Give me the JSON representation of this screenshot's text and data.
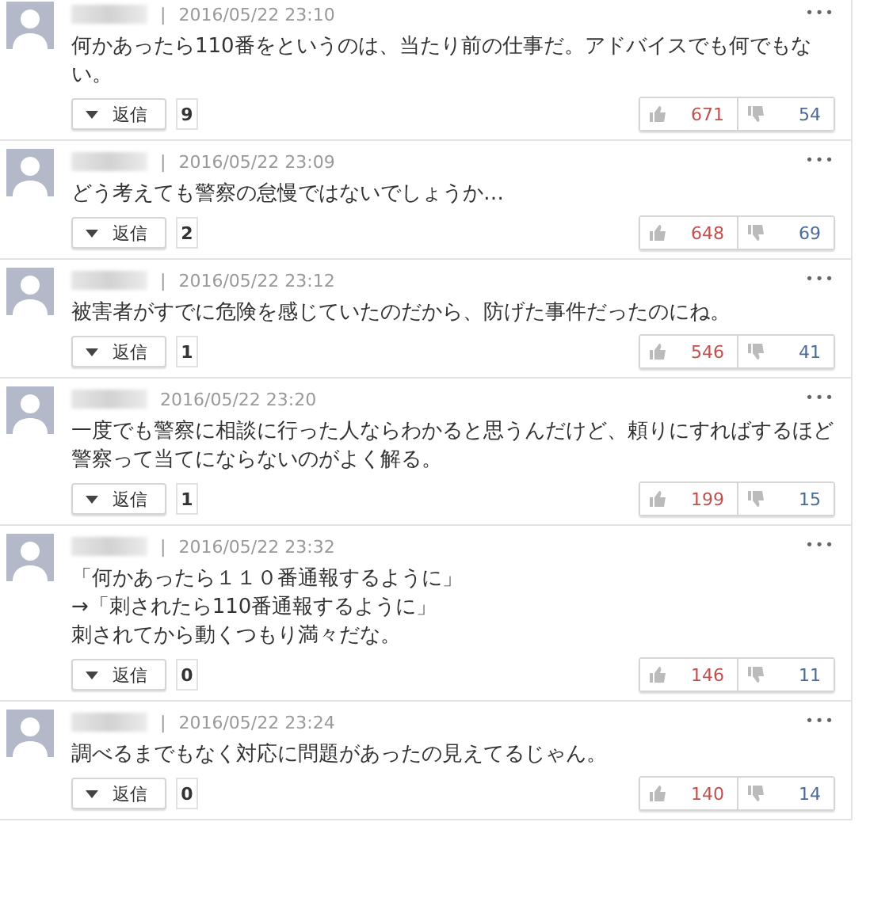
{
  "comments": [
    {
      "separator": "|",
      "date": "2016/05/22 23:10",
      "text": "何かあったら110番をというのは、当たり前の仕事だ。アドバイスでも何でもない。",
      "reply_label": "返信",
      "reply_count": "9",
      "likes": "671",
      "dislikes": "54",
      "menu": "•••"
    },
    {
      "separator": "|",
      "date": "2016/05/22 23:09",
      "text": "どう考えても警察の怠慢ではないでしょうか…",
      "reply_label": "返信",
      "reply_count": "2",
      "likes": "648",
      "dislikes": "69",
      "menu": "•••"
    },
    {
      "separator": "|",
      "date": "2016/05/22 23:12",
      "text": "被害者がすでに危険を感じていたのだから、防げた事件だったのにね。",
      "reply_label": "返信",
      "reply_count": "1",
      "likes": "546",
      "dislikes": "41",
      "menu": "•••"
    },
    {
      "date": "2016/05/22 23:20",
      "text": "一度でも警察に相談に行った人ならわかると思うんだけど、頼りにすればするほど警察って当てにならないのがよく解る。",
      "reply_label": "返信",
      "reply_count": "1",
      "likes": "199",
      "dislikes": "15",
      "menu": "•••"
    },
    {
      "separator": "|",
      "date": "2016/05/22 23:32",
      "text": "「何かあったら１１０番通報するように」",
      "text_lines": [
        "→「刺されたら110番通報するように」",
        "刺されてから動くつもり満々だな。"
      ],
      "reply_label": "返信",
      "reply_count": "0",
      "likes": "146",
      "dislikes": "11",
      "menu": "•••"
    },
    {
      "separator": "|",
      "date": "2016/05/22 23:24",
      "text": "調べるまでもなく対応に問題があったの見えてるじゃん。",
      "reply_label": "返信",
      "reply_count": "0",
      "likes": "140",
      "dislikes": "14",
      "menu": "•••"
    }
  ]
}
